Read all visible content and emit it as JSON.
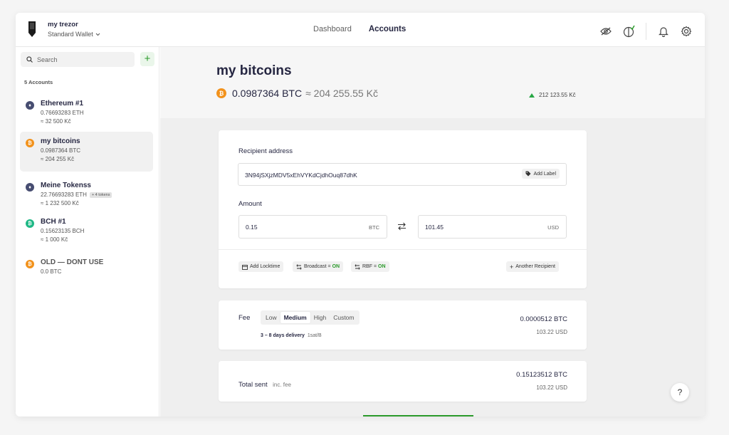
{
  "header": {
    "device_name": "my trezor",
    "wallet_label": "Standard Wallet",
    "nav": [
      "Dashboard",
      "Accounts"
    ],
    "nav_active_index": 1,
    "icons": [
      "eye-hidden-icon",
      "discreet-leaf-icon",
      "bell-icon",
      "gear-icon"
    ]
  },
  "sidebar": {
    "search_placeholder": "Search",
    "add_label": "+",
    "accounts_count": "5 Accounts",
    "accounts": [
      {
        "name": "Ethereum #1",
        "line1": "0.76693283 ETH",
        "line2": "≈ 32 500 Kč",
        "badge": "",
        "icon": "ethereum-icon",
        "color": "#474d71",
        "glyph": "♦",
        "selected": false
      },
      {
        "name": "my bitcoins",
        "line1": "0.0987364 BTC",
        "line2": "≈ 204 255 Kč",
        "badge": "",
        "icon": "bitcoin-icon",
        "color": "#f2921c",
        "glyph": "₿",
        "selected": true
      },
      {
        "name": "Meine Tokenss",
        "line1": "22.76693283 ETH",
        "line2": "≈ 1 232 500 Kč",
        "badge": "+ 4 tokens",
        "icon": "ethereum-icon",
        "color": "#474d71",
        "glyph": "♦",
        "selected": false
      },
      {
        "name": "BCH #1",
        "line1": "0.15623135 BCH",
        "line2": "≈ 1 000 Kč",
        "badge": "",
        "icon": "bitcoin-cash-icon",
        "color": "#1fb886",
        "glyph": "₿",
        "selected": false
      },
      {
        "name": "OLD — DONT USE",
        "line1": "0.0 BTC",
        "line2": "",
        "badge": "",
        "icon": "bitcoin-icon",
        "color": "#f2921c",
        "glyph": "₿",
        "selected": false
      }
    ]
  },
  "account": {
    "title": "my bitcoins",
    "balance_crypto": "0.0987364 BTC",
    "balance_fiat": "≈ 204 255.55 Kč",
    "delta": "212 123.55 Kč"
  },
  "send": {
    "recipient_label": "Recipient address",
    "address": "3N94jSXjzMDV5xEhVYKdCjdhOuq87dhK",
    "add_label": "Add Label",
    "amount_label": "Amount",
    "amount_crypto": "0.15",
    "amount_crypto_unit": "BTC",
    "amount_fiat": "101.45",
    "amount_fiat_unit": "USD",
    "locktime_label": "Add Locktime",
    "broadcast_label": "Broadcast =",
    "broadcast_value": "ON",
    "rbf_label": "RBF =",
    "rbf_value": "ON",
    "another_recipient": "Another Recipient"
  },
  "fee": {
    "label": "Fee",
    "options": [
      "Low",
      "Medium",
      "High",
      "Custom"
    ],
    "selected_index": 1,
    "delivery": "3 – 8 days delivery",
    "rate": "1sat/B",
    "amount_btc": "0.0000512 BTC",
    "amount_usd": "103.22 USD"
  },
  "total": {
    "label": "Total sent",
    "sub": "inc. fee",
    "amount_btc": "0.15123512 BTC",
    "amount_usd": "103.22 USD"
  },
  "help_label": "?"
}
